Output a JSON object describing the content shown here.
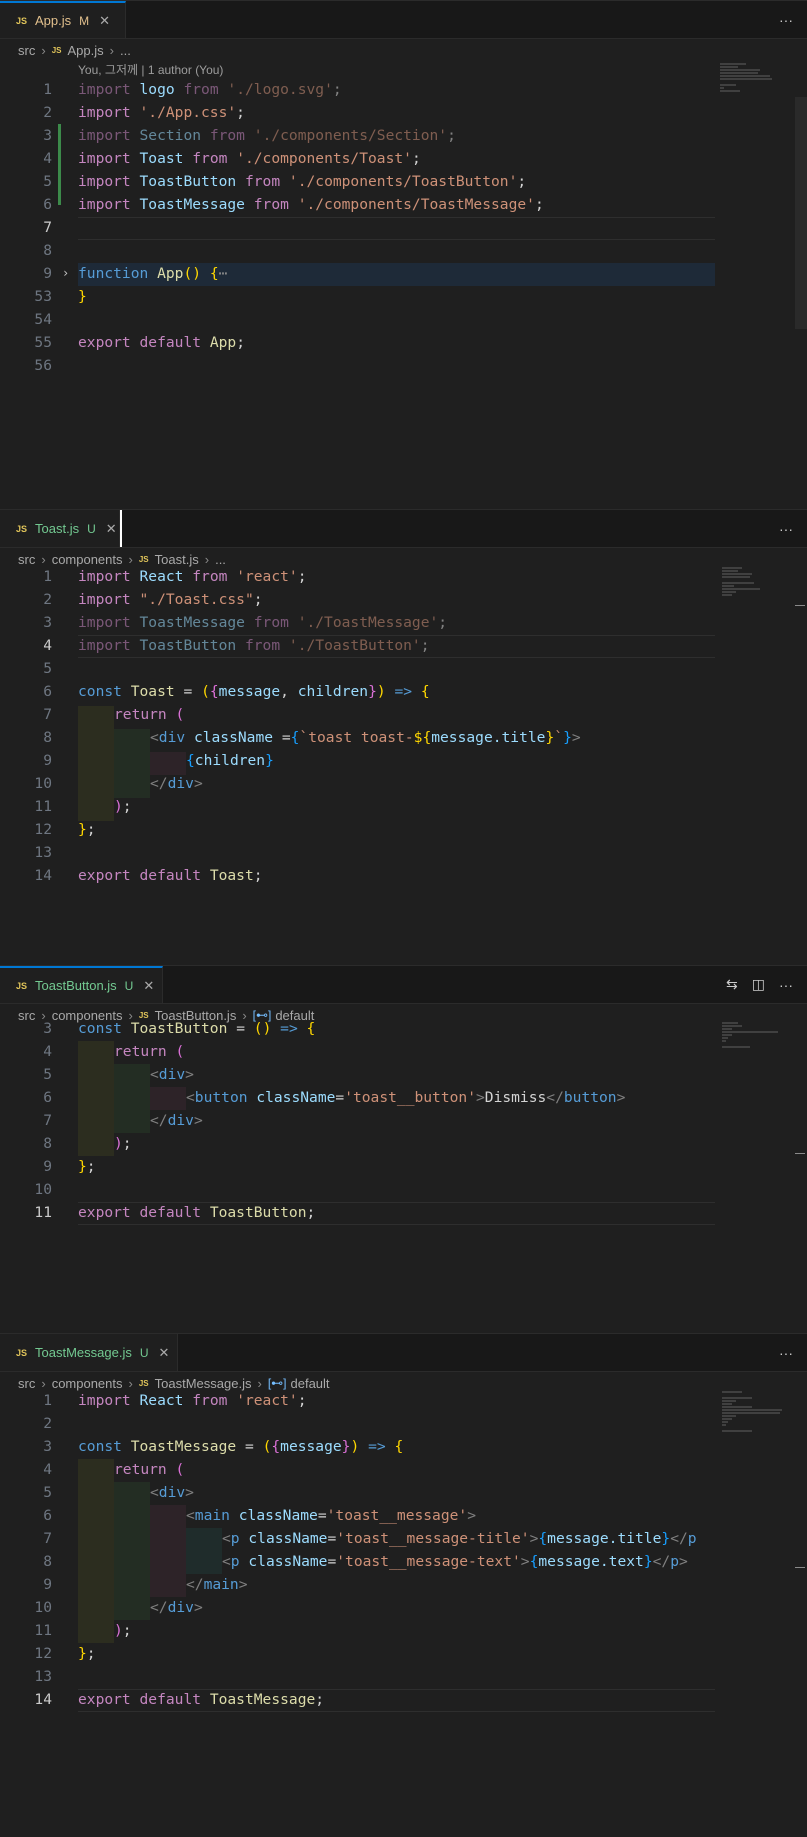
{
  "panes": [
    {
      "tab": {
        "name": "App.js",
        "badge": "M"
      },
      "breadcrumb": [
        "src",
        "App.js",
        "..."
      ],
      "blame": "You, 그저께 | 1 author (You)",
      "lines": [
        {
          "n": "1",
          "t": "import logo from './logo.svg';"
        },
        {
          "n": "2",
          "t": "import './App.css';"
        },
        {
          "n": "3",
          "t": "import Section from './components/Section';"
        },
        {
          "n": "4",
          "t": "import Toast from './components/Toast';"
        },
        {
          "n": "5",
          "t": "import ToastButton from './components/ToastButton';"
        },
        {
          "n": "6",
          "t": "import ToastMessage from './components/ToastMessage';"
        },
        {
          "n": "7",
          "t": ""
        },
        {
          "n": "8",
          "t": ""
        },
        {
          "n": "9",
          "t": "function App() {⋯"
        },
        {
          "n": "53",
          "t": "}"
        },
        {
          "n": "54",
          "t": ""
        },
        {
          "n": "55",
          "t": "export default App;"
        },
        {
          "n": "56",
          "t": ""
        }
      ]
    },
    {
      "tab": {
        "name": "Toast.js",
        "badge": "U"
      },
      "breadcrumb": [
        "src",
        "components",
        "Toast.js",
        "..."
      ],
      "lines": [
        {
          "n": "1",
          "t": "import React from 'react';"
        },
        {
          "n": "2",
          "t": "import \"./Toast.css\";"
        },
        {
          "n": "3",
          "t": "import ToastMessage from './ToastMessage';"
        },
        {
          "n": "4",
          "t": "import ToastButton from './ToastButton';"
        },
        {
          "n": "5",
          "t": ""
        },
        {
          "n": "6",
          "t": "const Toast = ({message, children}) => {"
        },
        {
          "n": "7",
          "t": "return ("
        },
        {
          "n": "8",
          "t": "<div className ={`toast toast-${message.title}`}>"
        },
        {
          "n": "9",
          "t": "{children}"
        },
        {
          "n": "10",
          "t": "</div>"
        },
        {
          "n": "11",
          "t": ");"
        },
        {
          "n": "12",
          "t": "};"
        },
        {
          "n": "13",
          "t": ""
        },
        {
          "n": "14",
          "t": "export default Toast;"
        }
      ]
    },
    {
      "tab": {
        "name": "ToastButton.js",
        "badge": "U"
      },
      "breadcrumb": [
        "src",
        "components",
        "ToastButton.js",
        "default"
      ],
      "lines": [
        {
          "n": "3",
          "t": "const ToastButton = () => {"
        },
        {
          "n": "4",
          "t": "return ("
        },
        {
          "n": "5",
          "t": "<div>"
        },
        {
          "n": "6",
          "t": "<button className='toast__button'>Dismiss</button>"
        },
        {
          "n": "7",
          "t": "</div>"
        },
        {
          "n": "8",
          "t": ");"
        },
        {
          "n": "9",
          "t": "};"
        },
        {
          "n": "10",
          "t": ""
        },
        {
          "n": "11",
          "t": "export default ToastButton;"
        }
      ]
    },
    {
      "tab": {
        "name": "ToastMessage.js",
        "badge": "U"
      },
      "breadcrumb": [
        "src",
        "components",
        "ToastMessage.js",
        "default"
      ],
      "lines": [
        {
          "n": "1",
          "t": "import React from 'react';"
        },
        {
          "n": "2",
          "t": ""
        },
        {
          "n": "3",
          "t": "const ToastMessage = ({message}) => {"
        },
        {
          "n": "4",
          "t": "return ("
        },
        {
          "n": "5",
          "t": "<div>"
        },
        {
          "n": "6",
          "t": "<main className='toast__message'>"
        },
        {
          "n": "7",
          "t": "<p className='toast__message-title'>{message.title}</p"
        },
        {
          "n": "8",
          "t": "<p className='toast__message-text'>{message.text}</p>"
        },
        {
          "n": "9",
          "t": "</main>"
        },
        {
          "n": "10",
          "t": "</div>"
        },
        {
          "n": "11",
          "t": ");"
        },
        {
          "n": "12",
          "t": "};"
        },
        {
          "n": "13",
          "t": ""
        },
        {
          "n": "14",
          "t": "export default ToastMessage;"
        }
      ]
    }
  ],
  "icons": {
    "more": "more-actions-icon",
    "split": "split-editor-icon",
    "compare": "open-changes-icon",
    "close": "close-icon",
    "symbol": "symbol-icon"
  },
  "colors": {
    "keyword": "#c586c0",
    "string": "#ce9178",
    "function": "#dcdcaa",
    "variable": "#9cdcfe",
    "modified": "#e2c08d",
    "untracked": "#73c991",
    "accent": "#0078d4"
  }
}
